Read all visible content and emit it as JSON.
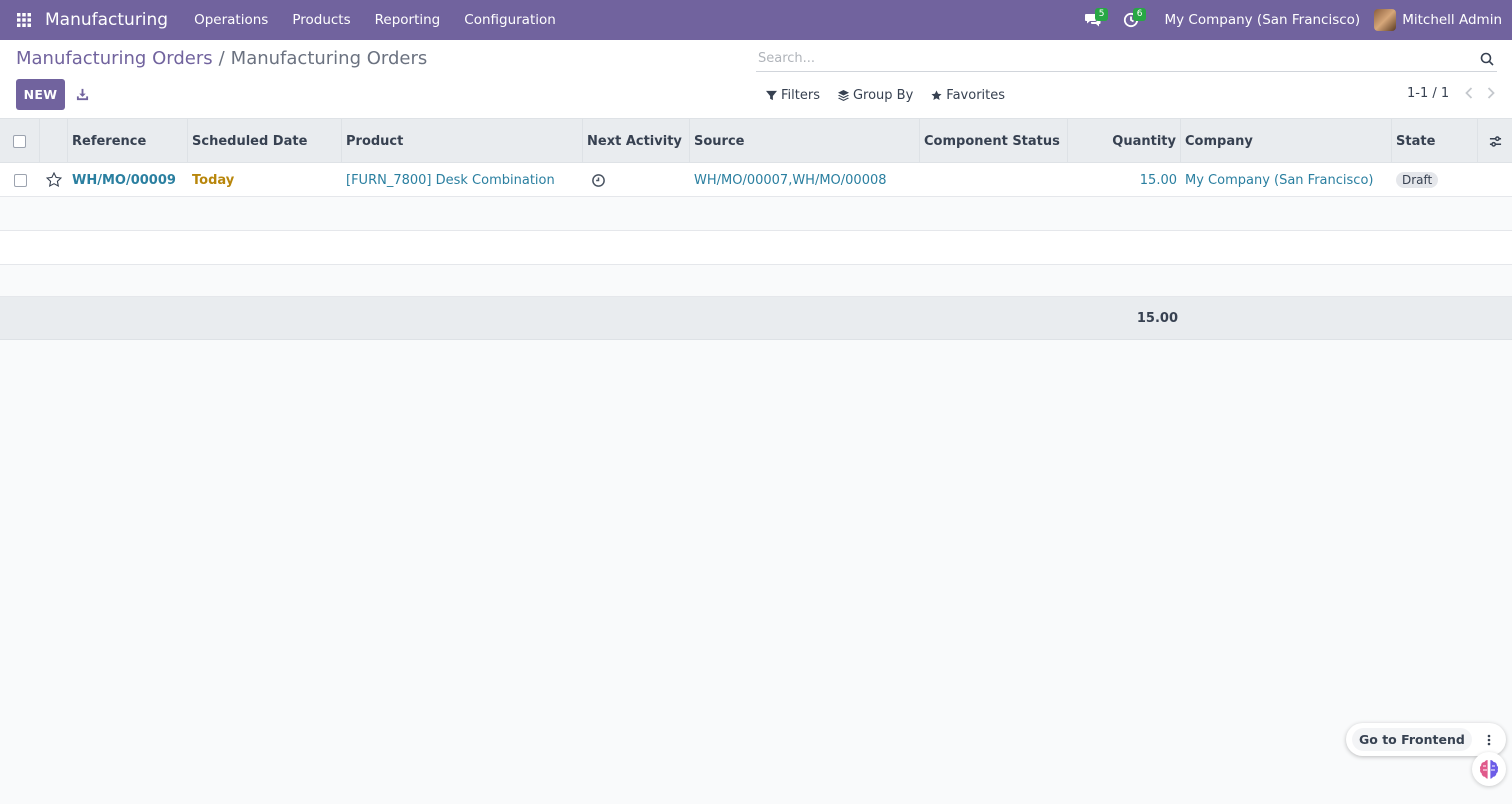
{
  "navbar": {
    "app_name": "Manufacturing",
    "menu": [
      "Operations",
      "Products",
      "Reporting",
      "Configuration"
    ],
    "messages_count": "5",
    "activities_count": "6",
    "company": "My Company (San Francisco)",
    "user": "Mitchell Admin",
    "colors": {
      "navbar": "#71639e"
    }
  },
  "control_panel": {
    "breadcrumb": [
      "Manufacturing Orders",
      "/",
      "Manufacturing Orders"
    ],
    "new_label": "NEW",
    "search_placeholder": "Search...",
    "filters_label": "Filters",
    "group_by_label": "Group By",
    "favorites_label": "Favorites",
    "pager": "1-1 / 1"
  },
  "table": {
    "headers": [
      "Reference",
      "Scheduled Date",
      "Product",
      "Next Activity",
      "Source",
      "Component Status",
      "Quantity",
      "Company",
      "State"
    ],
    "rows": [
      {
        "reference": "WH/MO/00009",
        "scheduled_date": "Today",
        "product": "[FURN_7800] Desk Combination",
        "source": "WH/MO/00007,WH/MO/00008",
        "component_status": "",
        "quantity": "15.00",
        "company": "My Company (San Francisco)",
        "state": "Draft"
      }
    ],
    "total_quantity": "15.00"
  },
  "floating": {
    "go_to_frontend": "Go to Frontend"
  }
}
